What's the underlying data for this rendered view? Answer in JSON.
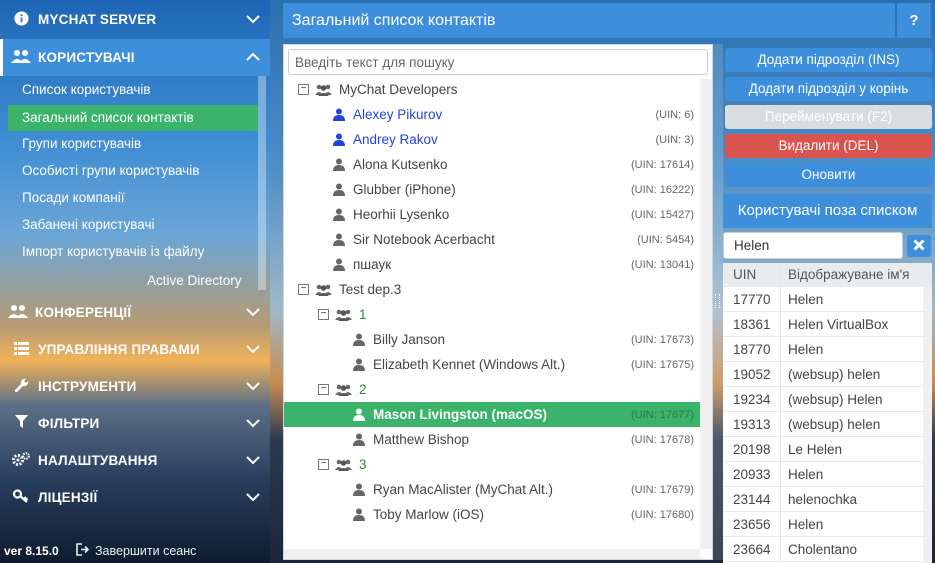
{
  "sidebar": {
    "server": {
      "label": "MYCHAT SERVER",
      "icon": "info-icon"
    },
    "users": {
      "label": "КОРИСТУВАЧІ",
      "icon": "users-icon"
    },
    "subitems": [
      "Список користувачів",
      "Загальний список контактів",
      "Групи користувачів",
      "Особисті групи користувачів",
      "Посади компанії",
      "Забанені користувачі",
      "Імпорт користувачів із файлу",
      "Active Directory"
    ],
    "sections": [
      {
        "label": "КОНФЕРЕНЦІЇ",
        "icon": "users-icon"
      },
      {
        "label": "УПРАВЛІННЯ ПРАВАМИ",
        "icon": "list-icon"
      },
      {
        "label": "ІНСТРУМЕНТИ",
        "icon": "wrench-icon"
      },
      {
        "label": "ФІЛЬТРИ",
        "icon": "filter-icon"
      },
      {
        "label": "НАЛАШТУВАННЯ",
        "icon": "gears-icon"
      },
      {
        "label": "ЛІЦЕНЗІЇ",
        "icon": "key-icon"
      }
    ],
    "version": "ver 8.15.0",
    "logout": "Завершити сеанс"
  },
  "header": {
    "title": "Загальний список контактів",
    "help": "?"
  },
  "search": {
    "placeholder": "Введіть текст для пошуку",
    "value": ""
  },
  "tree": [
    {
      "type": "group",
      "label": "MyChat Developers",
      "level": 0
    },
    {
      "type": "user",
      "label": "Alexey Pikurov",
      "uin": "(UIN: 6)",
      "level": 1,
      "online": true
    },
    {
      "type": "user",
      "label": "Andrey Rakov",
      "uin": "(UIN: 3)",
      "level": 1,
      "online": true
    },
    {
      "type": "user",
      "label": "Alona Kutsenko",
      "uin": "(UIN: 17614)",
      "level": 1
    },
    {
      "type": "user",
      "label": "Glubber (iPhone)",
      "uin": "(UIN: 16222)",
      "level": 1
    },
    {
      "type": "user",
      "label": "Heorhii Lysenko",
      "uin": "(UIN: 15427)",
      "level": 1
    },
    {
      "type": "user",
      "label": "Sir Notebook Acerbacht",
      "uin": "(UIN: 5454)",
      "level": 1
    },
    {
      "type": "user",
      "label": "пшаук",
      "uin": "(UIN: 13041)",
      "level": 1
    },
    {
      "type": "group",
      "label": "Test dep.3",
      "level": 0
    },
    {
      "type": "group",
      "label": "1",
      "level": 1,
      "numbered": true
    },
    {
      "type": "user",
      "label": "Billy Janson",
      "uin": "(UIN: 17673)",
      "level": 2
    },
    {
      "type": "user",
      "label": "Elizabeth Kennet (Windows Alt.)",
      "uin": "(UIN: 17675)",
      "level": 2
    },
    {
      "type": "group",
      "label": "2",
      "level": 1,
      "numbered": true
    },
    {
      "type": "user",
      "label": "Mason Livingston (macOS)",
      "uin": "(UIN: 17677)",
      "level": 2,
      "selected": true
    },
    {
      "type": "user",
      "label": "Matthew Bishop",
      "uin": "(UIN: 17678)",
      "level": 2
    },
    {
      "type": "group",
      "label": "3",
      "level": 1,
      "numbered": true
    },
    {
      "type": "user",
      "label": "Ryan MacAlister (MyChat Alt.)",
      "uin": "(UIN: 17679)",
      "level": 2
    },
    {
      "type": "user",
      "label": "Toby Marlow (iOS)",
      "uin": "(UIN: 17680)",
      "level": 2
    }
  ],
  "actions": {
    "add_sub": "Додати підрозділ (INS)",
    "add_root": "Додати підрозділ у корінь",
    "rename": "Перейменувати (F2)",
    "delete": "Видалити (DEL)",
    "refresh": "Оновити"
  },
  "outside": {
    "title": "Користувачі поза списком",
    "filter_value": "Helen",
    "col_uin": "UIN",
    "col_name": "Відображуване ім'я",
    "rows": [
      [
        "17770",
        "Helen"
      ],
      [
        "18361",
        "Helen VirtualBox"
      ],
      [
        "18770",
        "Helen"
      ],
      [
        "19052",
        "(websup) helen"
      ],
      [
        "19234",
        "(websup) Helen"
      ],
      [
        "19313",
        "(websup) helen"
      ],
      [
        "20198",
        "Le Helen"
      ],
      [
        "20933",
        "Helen"
      ],
      [
        "23144",
        "helenochka"
      ],
      [
        "23656",
        "Helen"
      ],
      [
        "23664",
        "Cholentano"
      ]
    ]
  },
  "colors": {
    "accent": "#3d8fdc",
    "selected": "#3bb36a",
    "danger": "#d9534f",
    "online": "#2244dd"
  }
}
